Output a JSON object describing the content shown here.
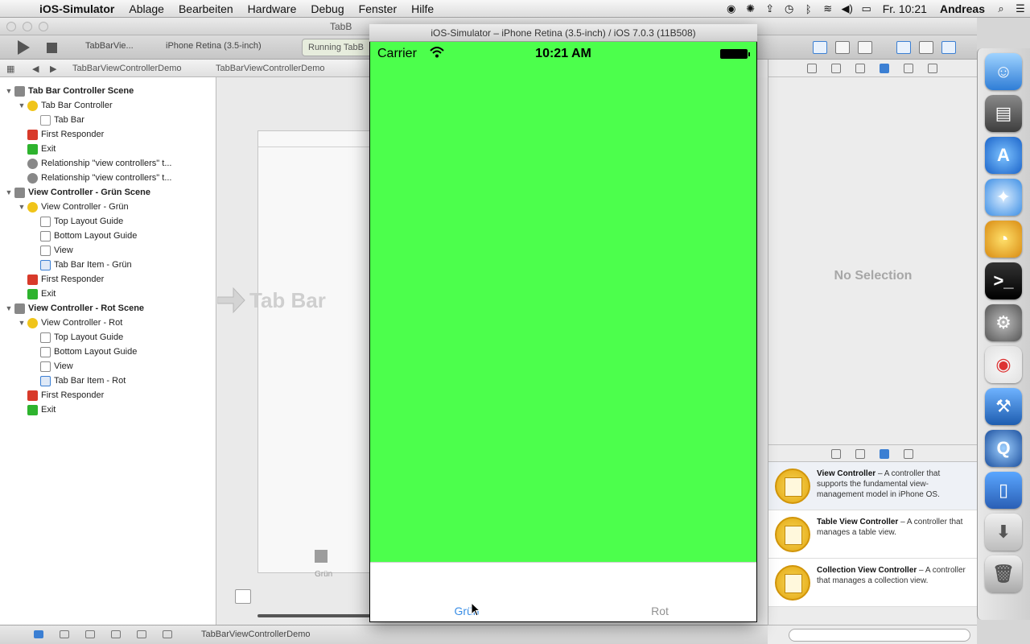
{
  "menubar": {
    "apple": "",
    "items": [
      "iOS-Simulator",
      "Ablage",
      "Bearbeiten",
      "Hardware",
      "Debug",
      "Fenster",
      "Hilfe"
    ],
    "clock": "Fr. 10:21",
    "user": "Andreas"
  },
  "xcode": {
    "title": "TabB",
    "toolbar": {
      "target": "TabBarVie...",
      "device": "iPhone Retina (3.5-inch)",
      "status": "Running TabB"
    },
    "jumpbar": [
      "TabBarViewControllerDemo",
      "TabBarViewControllerDemo"
    ],
    "navigator": [
      {
        "label": "Tab Bar Controller Scene",
        "level": 0,
        "icon": "scene",
        "bold": true,
        "disclosure": "▼"
      },
      {
        "label": "Tab Bar Controller",
        "level": 1,
        "icon": "vc",
        "bold": false,
        "disclosure": "▼"
      },
      {
        "label": "Tab Bar",
        "level": 2,
        "icon": "tabbar",
        "bold": false,
        "disclosure": ""
      },
      {
        "label": "First Responder",
        "level": 1,
        "icon": "responder",
        "bold": false,
        "disclosure": ""
      },
      {
        "label": "Exit",
        "level": 1,
        "icon": "exit",
        "bold": false,
        "disclosure": ""
      },
      {
        "label": "Relationship \"view controllers\" t...",
        "level": 1,
        "icon": "rel",
        "bold": false,
        "disclosure": ""
      },
      {
        "label": "Relationship \"view controllers\" t...",
        "level": 1,
        "icon": "rel",
        "bold": false,
        "disclosure": ""
      },
      {
        "label": "View Controller - Grün Scene",
        "level": 0,
        "icon": "scene",
        "bold": true,
        "disclosure": "▼"
      },
      {
        "label": "View Controller - Grün",
        "level": 1,
        "icon": "vc",
        "bold": false,
        "disclosure": "▼"
      },
      {
        "label": "Top Layout Guide",
        "level": 2,
        "icon": "guide",
        "bold": false,
        "disclosure": ""
      },
      {
        "label": "Bottom Layout Guide",
        "level": 2,
        "icon": "guide",
        "bold": false,
        "disclosure": ""
      },
      {
        "label": "View",
        "level": 2,
        "icon": "guide",
        "bold": false,
        "disclosure": ""
      },
      {
        "label": "Tab Bar Item - Grün",
        "level": 2,
        "icon": "tabitem",
        "bold": false,
        "disclosure": ""
      },
      {
        "label": "First Responder",
        "level": 1,
        "icon": "responder",
        "bold": false,
        "disclosure": ""
      },
      {
        "label": "Exit",
        "level": 1,
        "icon": "exit",
        "bold": false,
        "disclosure": ""
      },
      {
        "label": "View Controller - Rot Scene",
        "level": 0,
        "icon": "scene",
        "bold": true,
        "disclosure": "▼"
      },
      {
        "label": "View Controller - Rot",
        "level": 1,
        "icon": "vc",
        "bold": false,
        "disclosure": "▼"
      },
      {
        "label": "Top Layout Guide",
        "level": 2,
        "icon": "guide",
        "bold": false,
        "disclosure": ""
      },
      {
        "label": "Bottom Layout Guide",
        "level": 2,
        "icon": "guide",
        "bold": false,
        "disclosure": ""
      },
      {
        "label": "View",
        "level": 2,
        "icon": "guide",
        "bold": false,
        "disclosure": ""
      },
      {
        "label": "Tab Bar Item - Rot",
        "level": 2,
        "icon": "tabitem",
        "bold": false,
        "disclosure": ""
      },
      {
        "label": "First Responder",
        "level": 1,
        "icon": "responder",
        "bold": false,
        "disclosure": ""
      },
      {
        "label": "Exit",
        "level": 1,
        "icon": "exit",
        "bold": false,
        "disclosure": ""
      }
    ],
    "canvas": {
      "scene_title": "Tab Bar",
      "tab_label": "Grün"
    },
    "inspector": {
      "empty_label": "No Selection"
    },
    "library": [
      {
        "title": "View Controller",
        "desc": " – A controller that supports the fundamental view-management model in iPhone OS."
      },
      {
        "title": "Table View Controller",
        "desc": " – A controller that manages a table view."
      },
      {
        "title": "Collection View Controller",
        "desc": " – A controller that manages a collection view."
      }
    ],
    "debugbar": {
      "label": "TabBarViewControllerDemo"
    }
  },
  "simulator": {
    "title": "iOS-Simulator – iPhone Retina (3.5-inch) / iOS 7.0.3 (11B508)",
    "status": {
      "carrier": "Carrier",
      "time": "10:21 AM"
    },
    "screen_color": "#4cff4c",
    "tabs": [
      {
        "label": "Grün",
        "active": true
      },
      {
        "label": "Rot",
        "active": false
      }
    ]
  },
  "dock": {
    "items": [
      "finder-icon",
      "network-utility-icon",
      "app-store-icon",
      "safari-icon",
      "dashboard-icon",
      "terminal-icon",
      "system-preferences-icon",
      "chrome-icon",
      "xcode-icon",
      "quicktime-icon",
      "ios-simulator-icon",
      "downloads-icon",
      "trash-icon"
    ]
  }
}
